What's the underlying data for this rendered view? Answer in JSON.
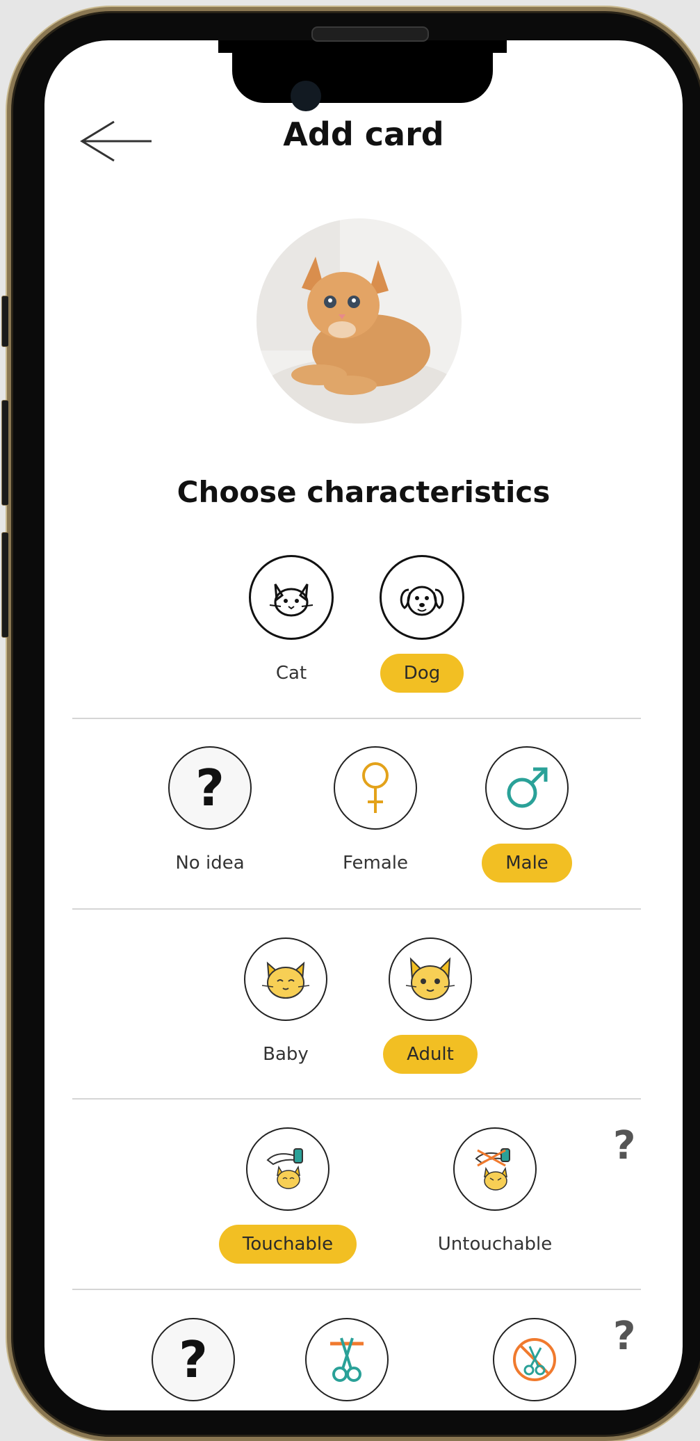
{
  "header": {
    "title": "Add card"
  },
  "section": {
    "title": "Choose characteristics"
  },
  "species": {
    "options": [
      "Cat",
      "Dog"
    ],
    "selected": "Dog"
  },
  "gender": {
    "options": [
      "No idea",
      "Female",
      "Male"
    ],
    "selected": "Male"
  },
  "age": {
    "options": [
      "Baby",
      "Adult"
    ],
    "selected": "Adult"
  },
  "touch": {
    "options": [
      "Touchable",
      "Untouchable"
    ],
    "selected": "Touchable",
    "help": "?"
  },
  "sterilization": {
    "options": [
      "No idea",
      "Sterilized",
      "Not sterilized"
    ],
    "help": "?"
  },
  "colors": {
    "accent": "#f2bf23",
    "teal": "#2aa198",
    "orange": "#f07a2e",
    "female": "#e3a21a"
  }
}
